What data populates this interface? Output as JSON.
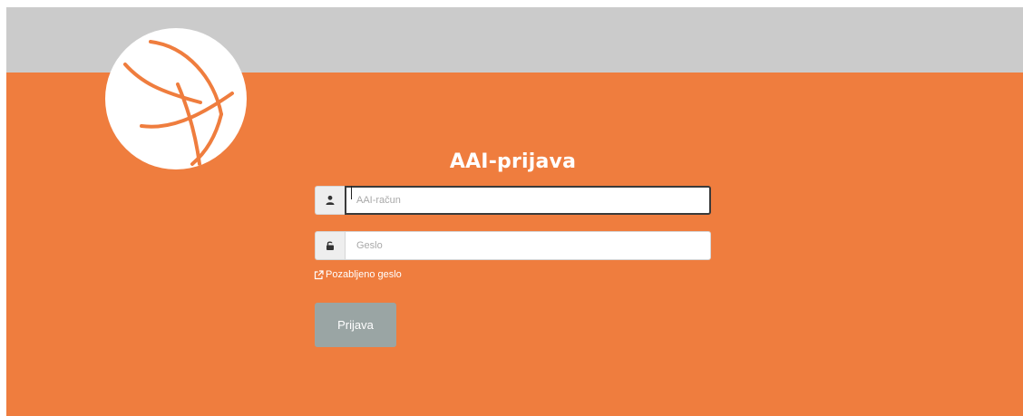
{
  "brand": {
    "header_color": "#cbcbcb",
    "accent_color": "#ef7d3e",
    "logo_stroke_color": "#ef7d3e"
  },
  "login": {
    "title": "AAI-prijava",
    "username": {
      "icon": "user-icon",
      "placeholder": "AAI-račun",
      "value": ""
    },
    "password": {
      "icon": "lock-icon",
      "placeholder": "Geslo",
      "value": ""
    },
    "forgot_link": {
      "icon": "external-link-icon",
      "label": "Pozabljeno geslo"
    },
    "submit_label": "Prijava"
  }
}
